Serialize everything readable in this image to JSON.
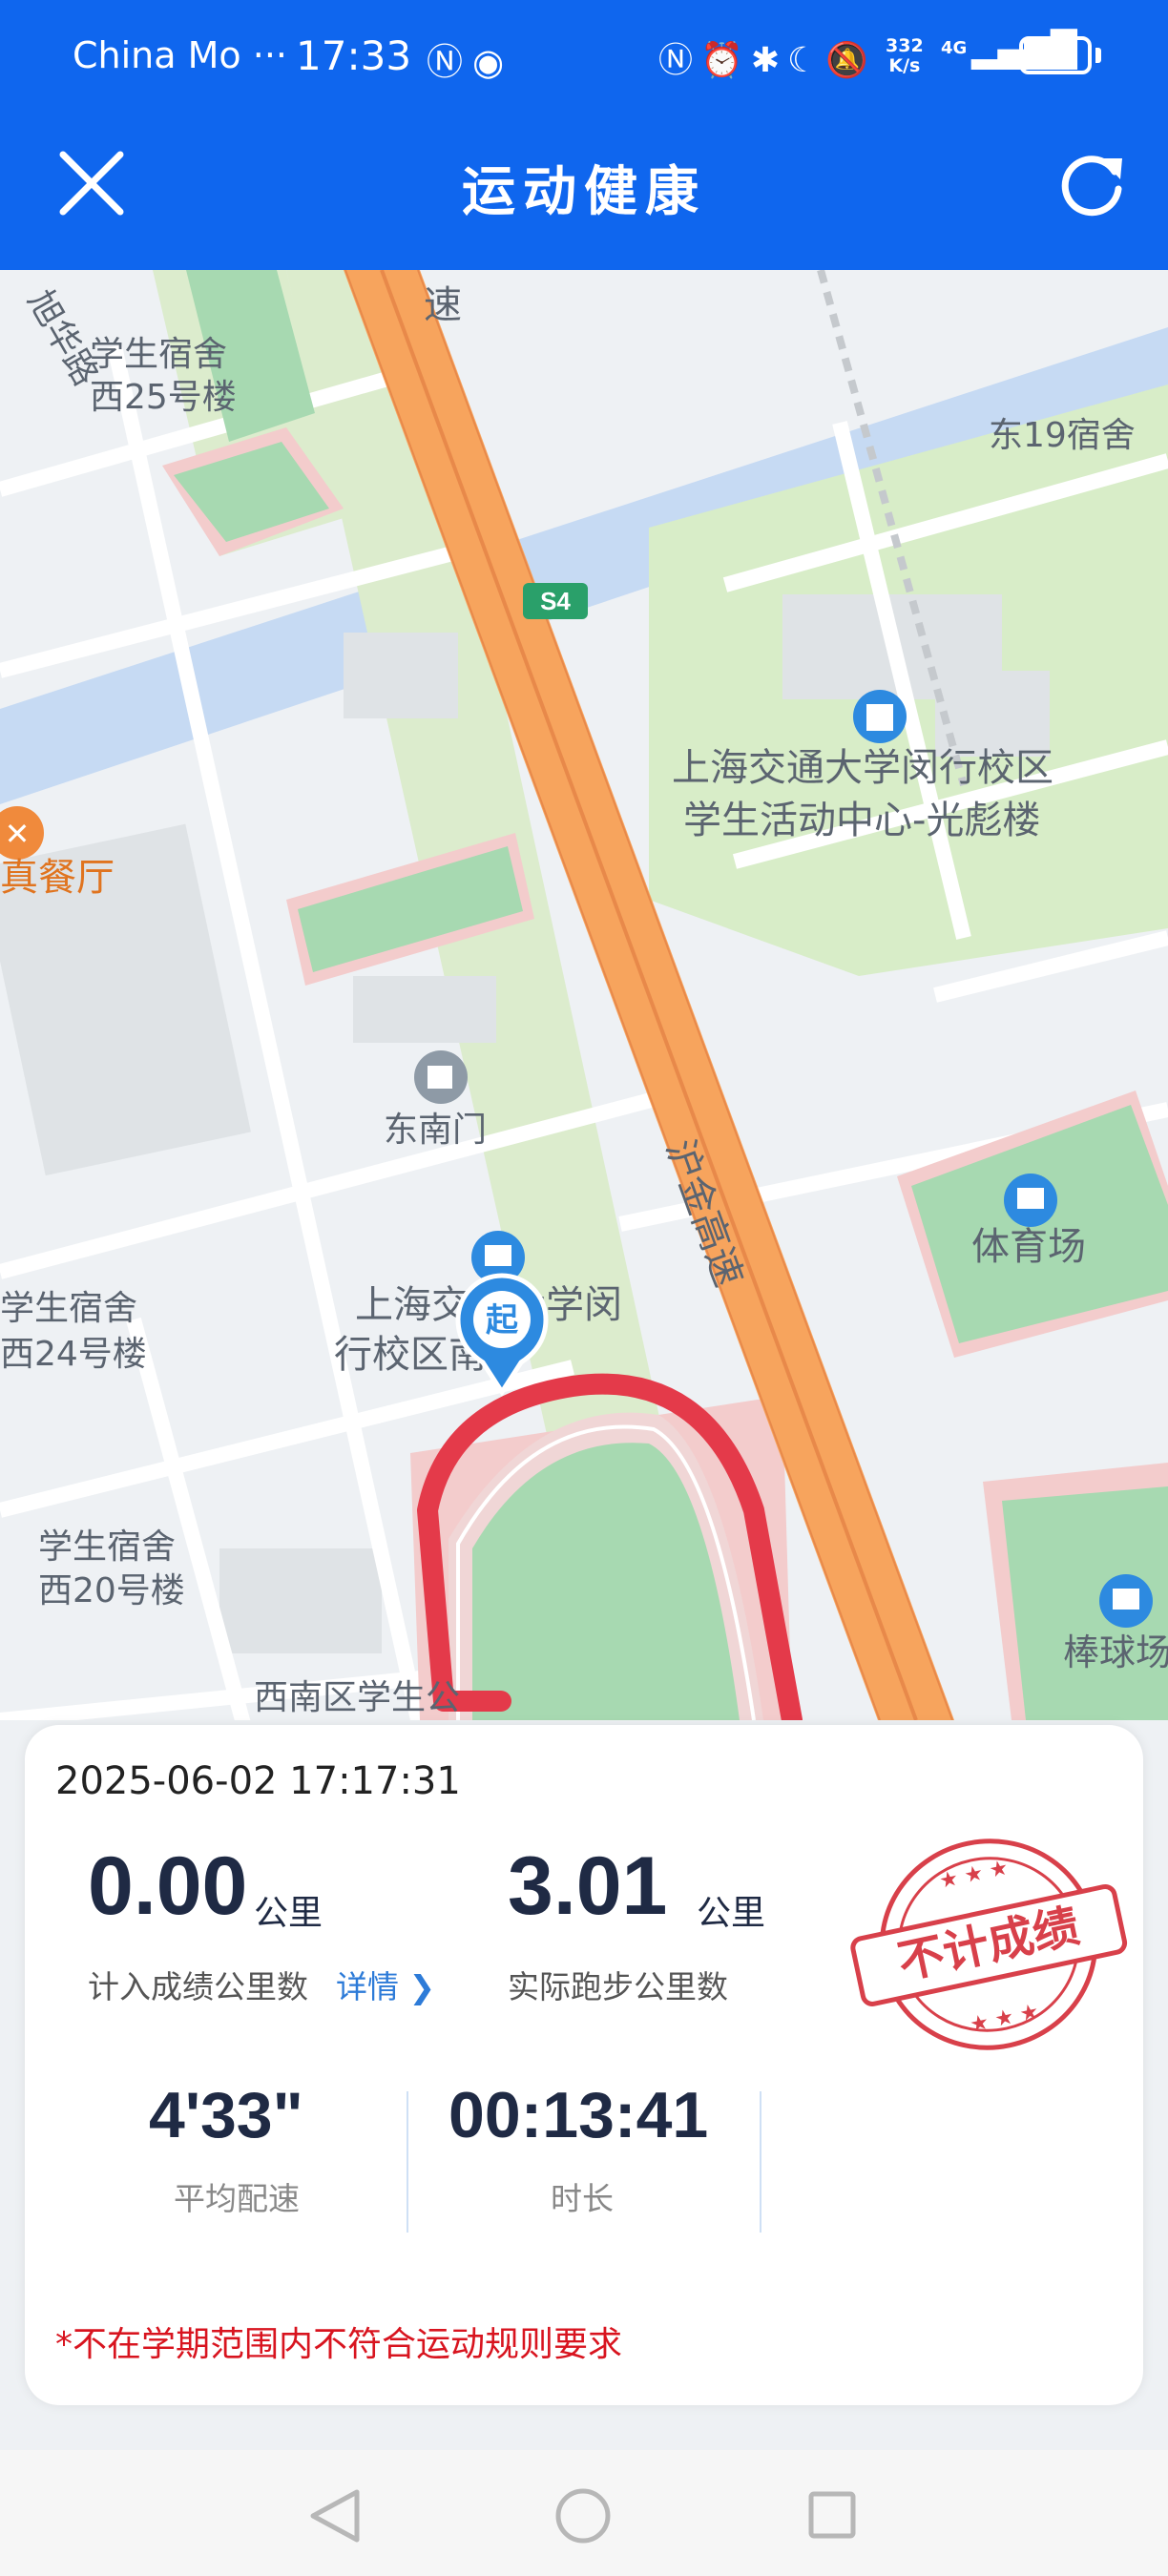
{
  "status_bar": {
    "carrier": "China Mo ···",
    "time": "17:33",
    "left_icons": "Ⓝ◉",
    "right_icons": "Ⓝ⏰✱☾🔕",
    "speed_value": "332",
    "speed_unit": "K/s",
    "network": "4G",
    "signal": "▂▄▆█",
    "battery": "57"
  },
  "header": {
    "title": "运动健康",
    "back_icon": "close-icon",
    "refresh_icon": "refresh-icon"
  },
  "map": {
    "labels": {
      "xuhua_road": "旭华路",
      "dorm_w25_1": "学生宿舍",
      "dorm_w25_2": "西25号楼",
      "dorm_e19": "东19宿舍",
      "s4_badge": "S4",
      "activity_center_1": "上海交通大学闵行校区",
      "activity_center_2": "学生活动中心-光彪楼",
      "restaurant": "真餐厅",
      "southeast_gate": "东南门",
      "highway_1": "速",
      "highway_2": "沪金高速",
      "stadium": "体育场",
      "dorm_w24_1": "学生宿舍",
      "dorm_w24_2": "西24号楼",
      "campus_1": "上海交通大学闵",
      "campus_2": "行校区南",
      "start_marker": "起",
      "dorm_w20_1": "学生宿舍",
      "dorm_w20_2": "西20号楼",
      "southwest_dorm": "西南区学生公",
      "baseball": "棒球场"
    },
    "colors": {
      "route": "#e43a4a",
      "highway": "#f7a45d",
      "water": "#c6daf3",
      "green": "#d8edc8",
      "base": "#eef1f4"
    }
  },
  "result_card": {
    "datetime": "2025-06-02 17:17:31",
    "credited_distance": "0.00",
    "credited_unit": "公里",
    "credited_label": "计入成绩公里数",
    "detail_link": "详情",
    "actual_distance": "3.01",
    "actual_unit": "公里",
    "actual_label": "实际跑步公里数",
    "avg_pace": "4'33\"",
    "avg_pace_label": "平均配速",
    "duration": "00:13:41",
    "duration_label": "时长",
    "stamp_text": "不计成绩",
    "warning": "*不在学期范围内不符合运动规则要求"
  },
  "navigation_bar": {
    "back": "back-triangle-icon",
    "home": "home-circle-icon",
    "recent": "recent-square-icon"
  }
}
